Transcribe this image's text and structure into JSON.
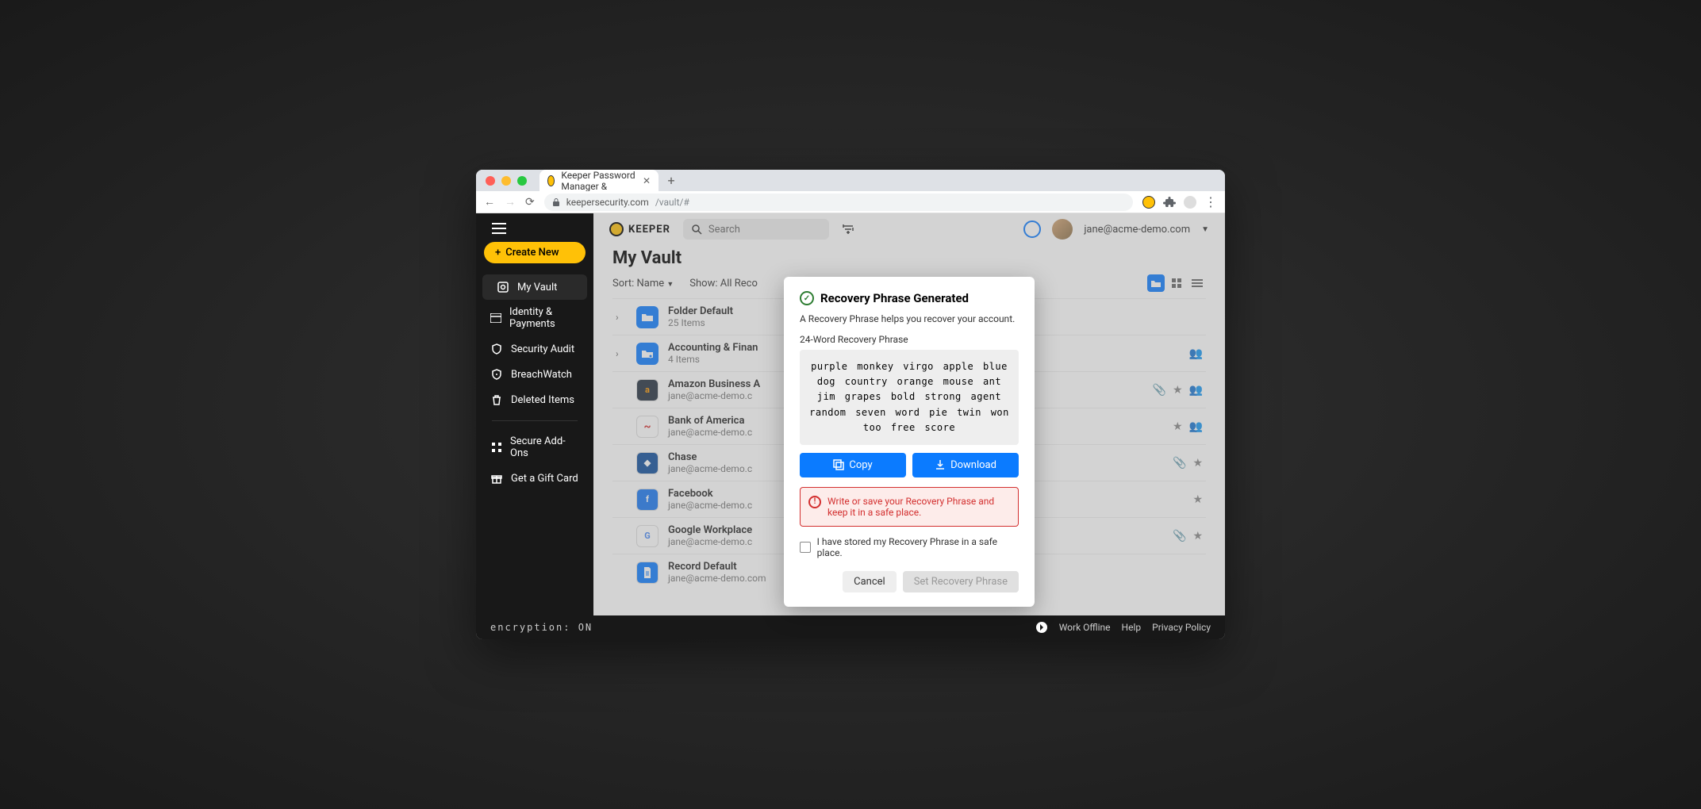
{
  "browser": {
    "tab_title": "Keeper Password Manager &",
    "url_host": "keepersecurity.com",
    "url_path": "/vault/#"
  },
  "sidebar": {
    "create_label": "Create New",
    "items": [
      {
        "label": "My Vault"
      },
      {
        "label": "Identity & Payments"
      },
      {
        "label": "Security Audit"
      },
      {
        "label": "BreachWatch"
      },
      {
        "label": "Deleted Items"
      }
    ],
    "secondary": [
      {
        "label": "Secure Add-Ons"
      },
      {
        "label": "Get a Gift Card"
      }
    ]
  },
  "header": {
    "logo_text": "KEEPER",
    "search_placeholder": "Search",
    "user_email": "jane@acme-demo.com"
  },
  "content": {
    "title": "My Vault",
    "sort_label": "Sort: Name",
    "show_label": "Show: All Reco",
    "rows": [
      {
        "title": "Folder Default",
        "sub": "25 Items",
        "type": "folder"
      },
      {
        "title": "Accounting & Finan",
        "sub": "4 Items",
        "type": "folder-shared"
      },
      {
        "title": "Amazon Business A",
        "sub": "jane@acme-demo.c",
        "icon": "a"
      },
      {
        "title": "Bank of America",
        "sub": "jane@acme-demo.c",
        "icon": "boa"
      },
      {
        "title": "Chase",
        "sub": "jane@acme-demo.c",
        "icon": "chase"
      },
      {
        "title": "Facebook",
        "sub": "jane@acme-demo.c",
        "icon": "fb"
      },
      {
        "title": "Google Workplace",
        "sub": "jane@acme-demo.c",
        "icon": "g"
      },
      {
        "title": "Record Default",
        "sub": "jane@acme-demo.com",
        "icon": "doc"
      }
    ]
  },
  "modal": {
    "title": "Recovery Phrase Generated",
    "subtitle": "A Recovery Phrase helps you recover your account.",
    "label": "24-Word Recovery Phrase",
    "phrase": "purple monkey virgo apple blue dog country orange mouse ant jim grapes bold strong agent random seven word pie twin won too free score",
    "copy_label": "Copy",
    "download_label": "Download",
    "warning": "Write or save your Recovery Phrase and keep it in a safe place.",
    "checkbox_label": "I have stored my Recovery Phrase in a safe place.",
    "cancel_label": "Cancel",
    "submit_label": "Set Recovery Phrase"
  },
  "footer": {
    "encryption": "encryption: ON",
    "offline": "Work Offline",
    "help": "Help",
    "privacy": "Privacy Policy"
  }
}
